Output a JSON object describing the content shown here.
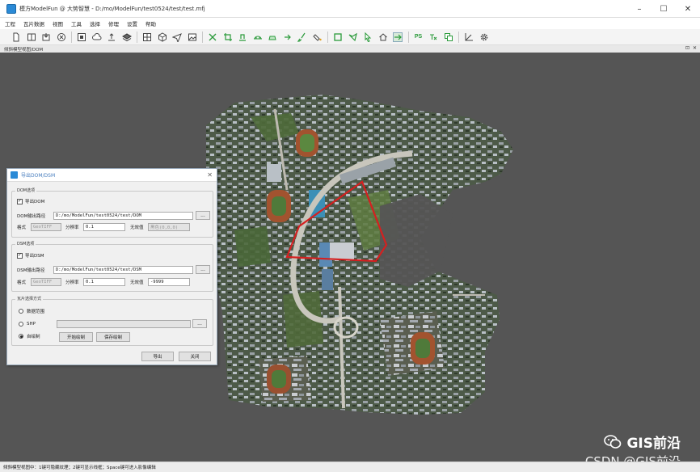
{
  "window": {
    "title": "模方ModelFun @ 大势智慧 - D:/mo/ModelFun/test0524/test/test.mfj",
    "minimize": "–",
    "maximize": "☐",
    "close": "✕"
  },
  "menu": [
    "工程",
    "瓦片数据",
    "视图",
    "工具",
    "选择",
    "修理",
    "设置",
    "帮助"
  ],
  "toolbar": {
    "groups": [
      [
        "new-file-icon",
        "open-book-icon",
        "import-icon",
        "close-circle-icon"
      ],
      [
        "stop-icon",
        "cloud-icon",
        "export-icon",
        "layers-icon"
      ],
      [
        "grid-icon",
        "cube-icon",
        "plane-icon",
        "image-icon"
      ],
      [
        "cut-icon",
        "crop-icon",
        "flatten-icon",
        "bridge-icon",
        "fill-icon",
        "arrow-tool-icon",
        "brush-icon",
        "paint-icon"
      ],
      [
        "rect-select-icon",
        "poly-select-icon",
        "pointer-icon",
        "house-icon",
        "move-icon"
      ],
      [
        "ps-icon",
        "texture-icon",
        "copy-icon"
      ],
      [
        "measure-icon",
        "gear-icon"
      ]
    ],
    "ps_text": "PS"
  },
  "panel": {
    "title": "倾斜模型视图/DOM",
    "controls": [
      "⊡",
      "✕"
    ]
  },
  "dialog": {
    "title": "导出DOM/DSM",
    "close": "✕",
    "dom_group": {
      "title": "DOM选项",
      "export_label": "导出DOM",
      "export_checked": true,
      "path_label": "DOM输出路径",
      "path_value": "D:/mo/ModelFun/test0524/test/DOM",
      "browse": "...",
      "format_label": "格式",
      "format_value": "GeoTIFF",
      "resolution_label": "分辨率",
      "resolution_value": "0.1",
      "nodata_label": "无效值",
      "nodata_value": "黑色(0,0,0)"
    },
    "dsm_group": {
      "title": "DSM选项",
      "export_label": "导出DSM",
      "export_checked": true,
      "path_label": "DSM输出路径",
      "path_value": "D:/mo/ModelFun/test0524/test/DSM",
      "browse": "...",
      "format_label": "格式",
      "format_value": "GeoTIFF",
      "resolution_label": "分辨率",
      "resolution_value": "0.1",
      "nodata_label": "无效值",
      "nodata_value": "-9999"
    },
    "tile_group": {
      "title": "瓦片选择方式",
      "option_extent": "数据范围",
      "option_shp": "SHP",
      "option_draw": "自绘制",
      "selected": "自绘制",
      "shp_browse": "...",
      "start_draw": "开始绘制",
      "save_draw": "保存绘制"
    },
    "export_button": "导出",
    "close_button": "关闭"
  },
  "statusbar": {
    "text": "倾斜模型视图中：1键可隐藏纹理；2键可显示线框；Space键可进入影像编辑"
  },
  "watermark": {
    "line1": "GIS前沿",
    "line2": "CSDN @GIS前沿"
  },
  "colors": {
    "selection_polygon": "#d42020",
    "viewport_bg": "#555555",
    "accent": "#2b8ad6"
  }
}
